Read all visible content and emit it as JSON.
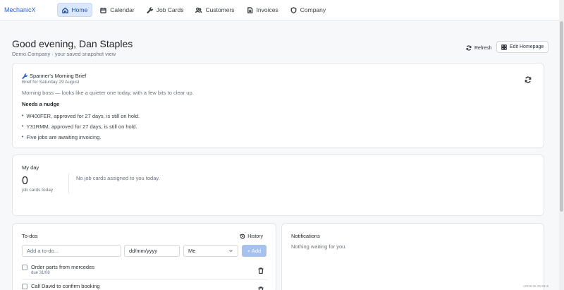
{
  "app": {
    "brand": "MechanicX"
  },
  "nav": {
    "items": [
      {
        "label": "Home",
        "icon": "home-icon",
        "active": true
      },
      {
        "label": "Calendar",
        "icon": "calendar-icon"
      },
      {
        "label": "Job Cards",
        "icon": "wrench-icon"
      },
      {
        "label": "Customers",
        "icon": "users-icon"
      },
      {
        "label": "Invoices",
        "icon": "invoice-icon"
      },
      {
        "label": "Company",
        "icon": "shield-icon"
      }
    ]
  },
  "header": {
    "greeting": "Good evening, Dan Staples",
    "subtitle": "Demo.Company · your saved snapshot view",
    "refresh_label": "Refresh",
    "edit_label": "Edit Homepage"
  },
  "brief": {
    "title": "Spanner's Morning Brief",
    "date": "Brief for Saturday 29 August",
    "intro": "Morning boss — looks like a quieter one today, with a few bits to clear up.",
    "section_heading": "Needs a nudge",
    "items": [
      "W400FER, approved for 27 days, is still on hold.",
      "Y31RMM, approved for 27 days, is still on hold.",
      "Five jobs are awaiting invoicing."
    ]
  },
  "my_day": {
    "title": "My day",
    "count": "0",
    "count_label": "job cards today",
    "empty_message": "No job cards assigned to you today."
  },
  "todos": {
    "title": "To-dos",
    "history_label": "History",
    "input_placeholder": "Add a to-do...",
    "date_placeholder": "dd/mm/yyyy",
    "assignee_value": "Me",
    "add_label": "+ Add",
    "items": [
      {
        "text": "Order parts from mercedes",
        "due": "due 31/08"
      },
      {
        "text": "Call David to confirm booking",
        "due": ""
      }
    ]
  },
  "notifications": {
    "title": "Notifications",
    "empty_message": "Nothing waiting for you."
  },
  "footer": {
    "version": "c2026.08.29-8818"
  },
  "colors": {
    "accent": "#2f64c8",
    "nav_active_bg": "#dbe7fb",
    "add_button": "#a7c1ee"
  }
}
